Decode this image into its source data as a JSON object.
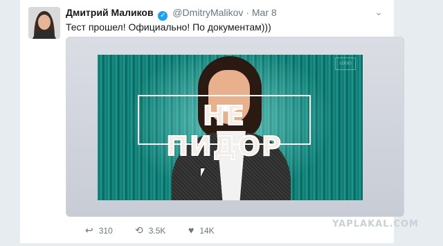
{
  "tweet": {
    "display_name": "Дмитрий Маликов",
    "handle": "@DmitryMalikov",
    "separator": "·",
    "date": "Mar 8",
    "text": "Тест прошел! Официально! По документам)))",
    "verified_glyph": "✓",
    "menu_glyph": "⌄"
  },
  "media": {
    "overlay_text": "НЕ ПИДОР",
    "corner_logo": "LOGO"
  },
  "actions": {
    "reply": {
      "icon": "reply-icon",
      "glyph": "↩",
      "count": "310"
    },
    "retweet": {
      "icon": "retweet-icon",
      "glyph": "⟲",
      "count": "3.5K"
    },
    "like": {
      "icon": "heart-icon",
      "glyph": "♥",
      "count": "14K"
    }
  },
  "watermark": "YAPLAKAL.COM",
  "colors": {
    "link_blue": "#1da1f2",
    "text_primary": "#14171a",
    "text_secondary": "#657786",
    "background": "#e6ecf0"
  }
}
